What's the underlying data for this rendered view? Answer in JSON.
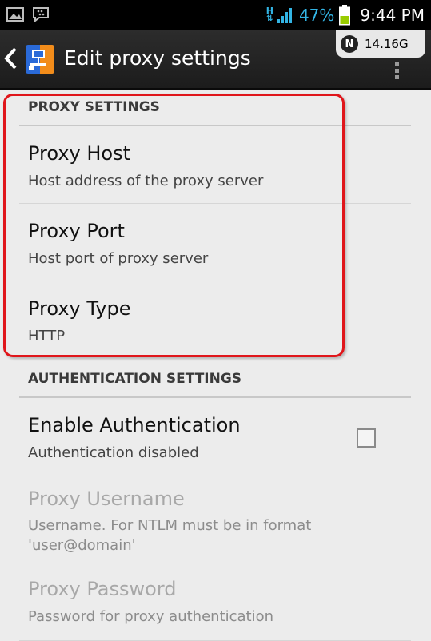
{
  "status_bar": {
    "network_type": "H",
    "battery_percent": "47%",
    "time": "9:44 PM"
  },
  "action_bar": {
    "title": "Edit proxy settings",
    "data_badge_letter": "N",
    "data_usage": "14.16G"
  },
  "sections": [
    {
      "header": "PROXY SETTINGS",
      "items": [
        {
          "title": "Proxy Host",
          "summary": "Host address of the proxy server"
        },
        {
          "title": "Proxy Port",
          "summary": "Host port of proxy server"
        },
        {
          "title": "Proxy Type",
          "summary": "HTTP"
        }
      ]
    },
    {
      "header": "AUTHENTICATION SETTINGS",
      "items": [
        {
          "title": "Enable Authentication",
          "summary": "Authentication disabled",
          "checked": false
        },
        {
          "title": "Proxy Username",
          "summary_line1": "Username. For NTLM must be in format",
          "summary_line2": "'user@domain'",
          "enabled": false
        },
        {
          "title": "Proxy Password",
          "summary": "Password for proxy authentication",
          "enabled": false
        }
      ]
    }
  ],
  "colors": {
    "accent": "#33b5e5",
    "highlight": "#e0161b",
    "background": "#ececec"
  }
}
